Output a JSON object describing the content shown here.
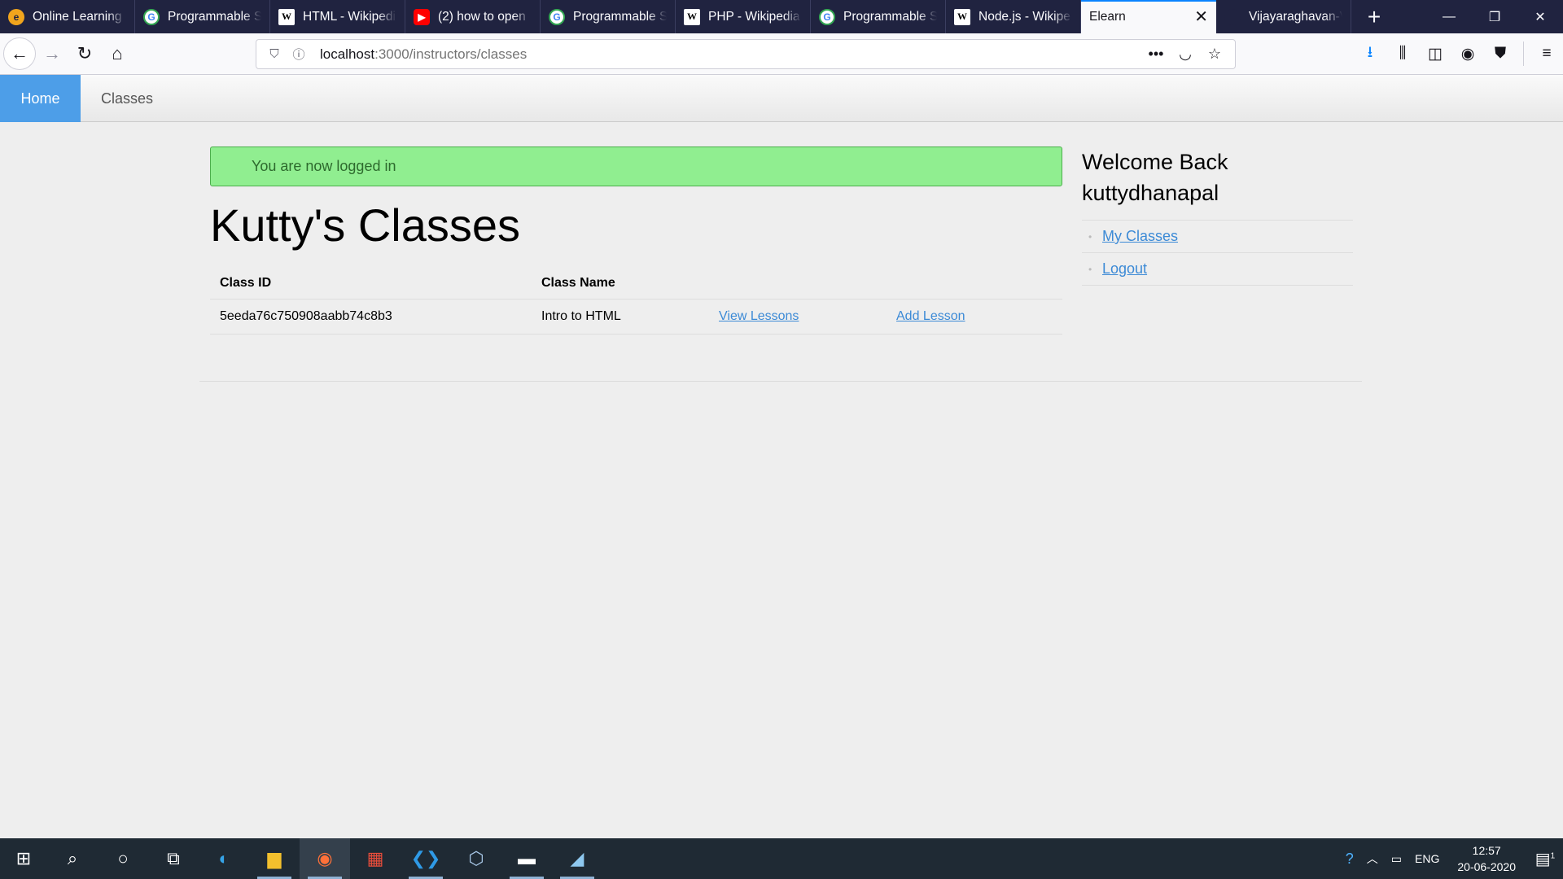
{
  "browser": {
    "tabs": [
      {
        "title": "Online Learning (",
        "icon": "edureka-icon",
        "active": false
      },
      {
        "title": "Programmable S",
        "icon": "google-icon",
        "active": false
      },
      {
        "title": "HTML - Wikipedi",
        "icon": "wikipedia-icon",
        "active": false
      },
      {
        "title": "(2) how to open",
        "icon": "youtube-icon",
        "active": false
      },
      {
        "title": "Programmable S",
        "icon": "google-icon",
        "active": false
      },
      {
        "title": "PHP - Wikipedia",
        "icon": "wikipedia-icon",
        "active": false
      },
      {
        "title": "Programmable S",
        "icon": "google-icon",
        "active": false
      },
      {
        "title": "Node.js - Wikipe",
        "icon": "wikipedia-icon",
        "active": false
      },
      {
        "title": "Elearn",
        "icon": "",
        "active": true
      },
      {
        "title": "Vijayaraghavan-V",
        "icon": "github-icon",
        "active": false
      }
    ],
    "url": {
      "host": "localhost",
      "path": ":3000/instructors/classes"
    }
  },
  "site_nav": {
    "home": "Home",
    "classes": "Classes"
  },
  "main": {
    "alert": "You are now logged in",
    "title": "Kutty's Classes",
    "table": {
      "headers": [
        "Class ID",
        "Class Name",
        "",
        ""
      ],
      "rows": [
        {
          "id": "5eeda76c750908aabb74c8b3",
          "name": "Intro to HTML",
          "view": "View Lessons",
          "add": "Add Lesson"
        }
      ]
    }
  },
  "sidebar": {
    "welcome_line1": "Welcome Back",
    "welcome_line2": "kuttydhanapal",
    "links": [
      "My Classes",
      "Logout"
    ]
  },
  "taskbar": {
    "lang": "ENG",
    "time": "12:57",
    "date": "20-06-2020",
    "notification_count": "1"
  },
  "colors": {
    "accent": "#4d9ee8",
    "alert_bg": "#90ee90",
    "link": "#3c8ad6",
    "tab_active_indicator": "#0a84ff"
  }
}
